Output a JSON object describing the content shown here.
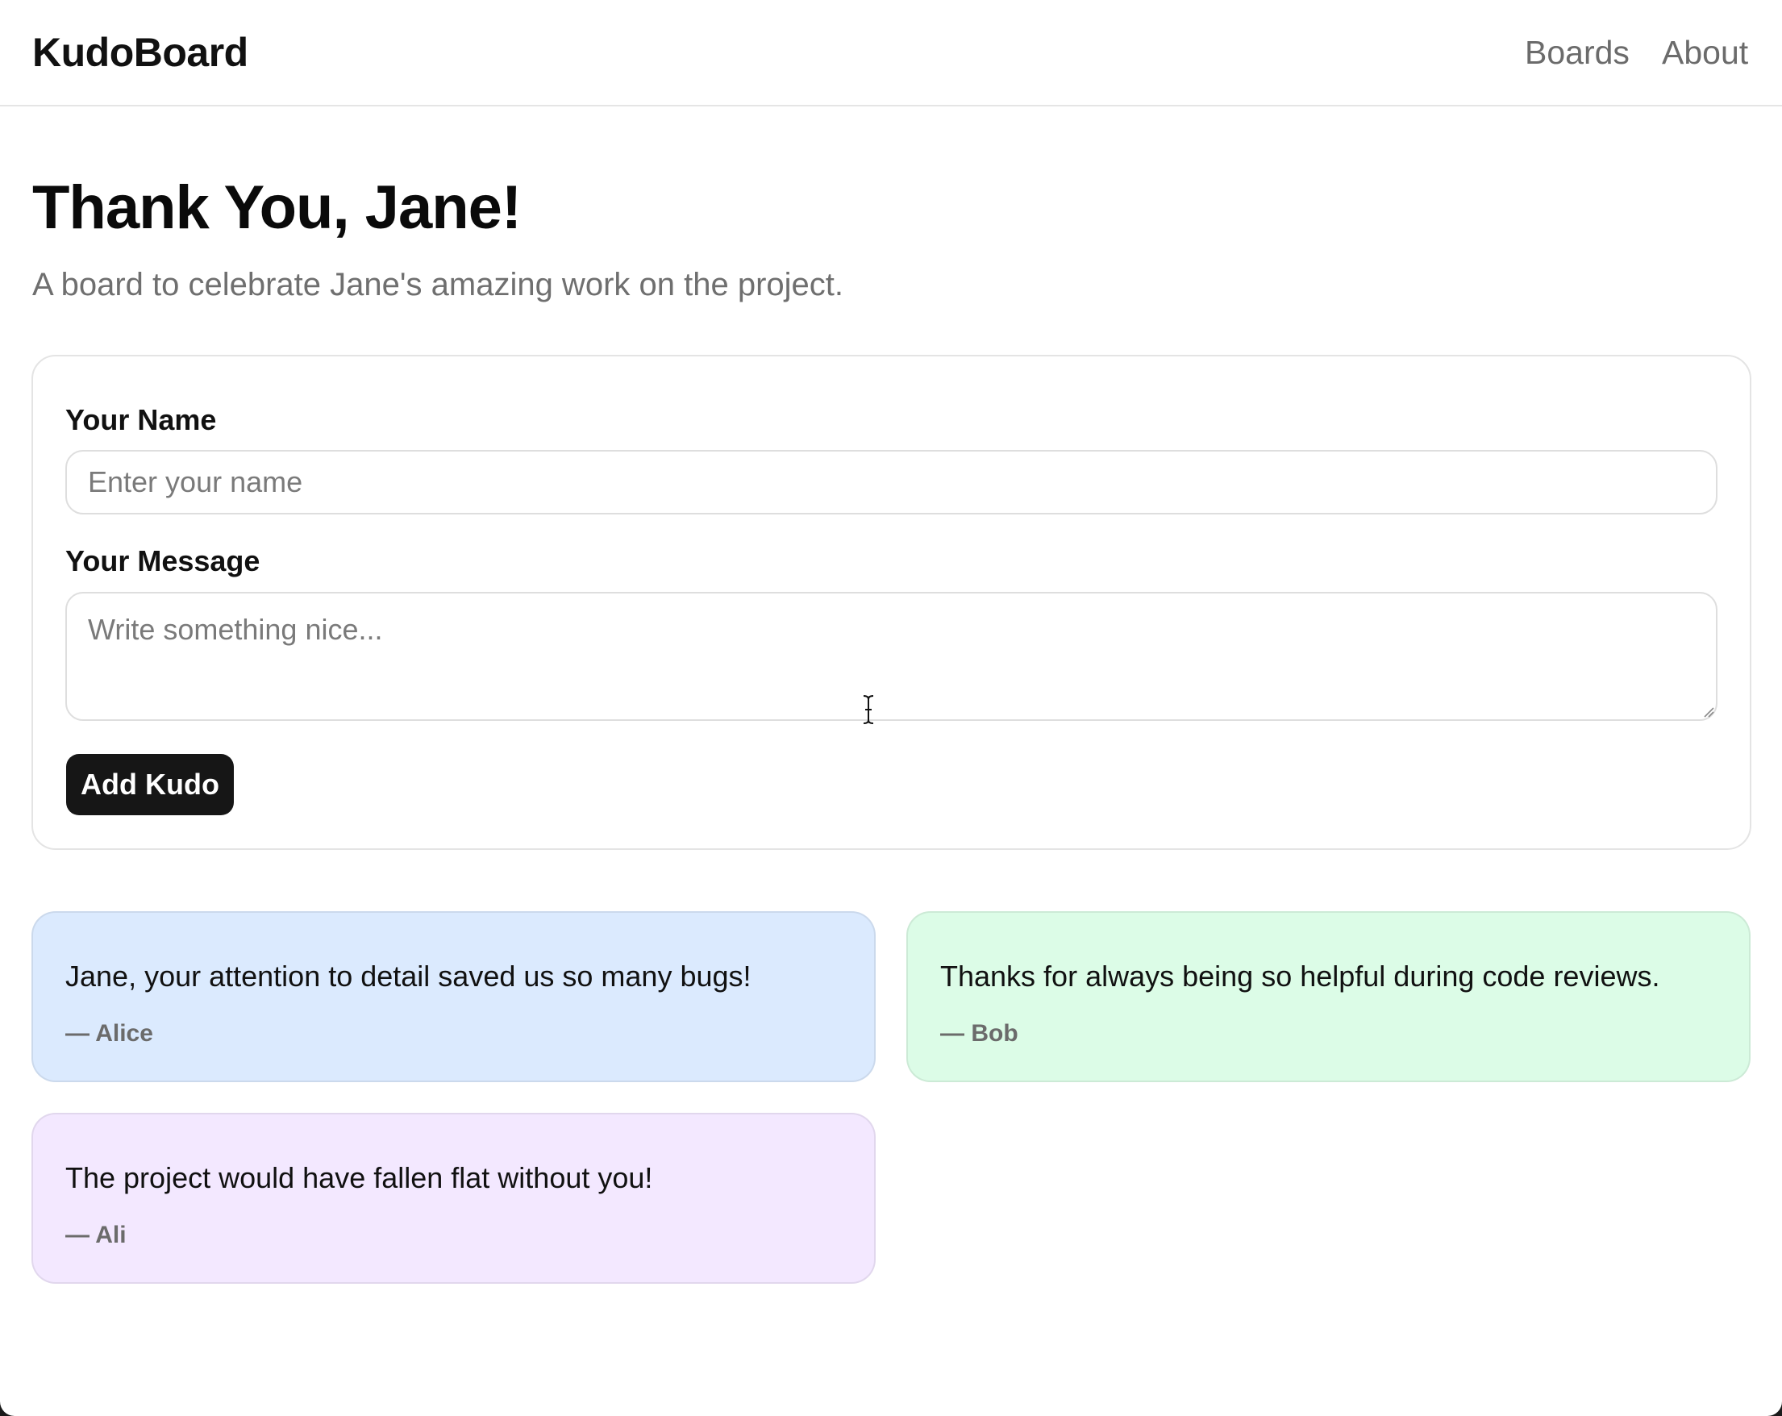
{
  "header": {
    "logo": "KudoBoard",
    "nav": [
      {
        "label": "Boards"
      },
      {
        "label": "About"
      }
    ]
  },
  "board": {
    "title": "Thank You, Jane!",
    "subtitle": "A board to celebrate Jane's amazing work on the project."
  },
  "form": {
    "name_label": "Your Name",
    "name_placeholder": "Enter your name",
    "name_value": "",
    "message_label": "Your Message",
    "message_placeholder": "Write something nice...",
    "message_value": "",
    "submit_label": "Add Kudo"
  },
  "kudos": [
    {
      "message": "Jane, your attention to detail saved us so many bugs!",
      "author": "— Alice",
      "color": "#dbeafe"
    },
    {
      "message": "Thanks for always being so helpful during code reviews.",
      "author": "— Bob",
      "color": "#dcfce7"
    },
    {
      "message": "The project would have fallen flat without you!",
      "author": "— Ali",
      "color": "#f3e8ff"
    }
  ],
  "colors": {
    "primary_button": "#161616",
    "muted_text": "#6b6b6b"
  },
  "icons": {
    "cursor": "text-cursor-icon",
    "resize": "resize-grip-icon"
  }
}
